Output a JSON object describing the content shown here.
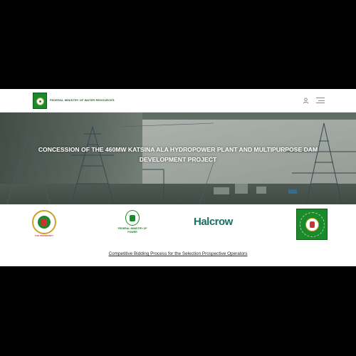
{
  "header": {
    "logo_text": "FEDERAL MINISTRY OF WATER RESOURCES",
    "icons": [
      "user-icon",
      "hamburger-menu-icon"
    ]
  },
  "hero": {
    "title": "CONCESSION OF THE 460MW KATSINA ALA HYDROPOWER PLANT AND MULTIPURPOSE DAM DEVELOPMENT PROJECT"
  },
  "partners": {
    "presidency_caption": "THE PRESIDENCY",
    "fmp_label": "FEDERAL MINISTRY OF POWER",
    "halcrow_label": "Halcrow",
    "fmwr_seal": "FEDERAL MINISTRY OF WATER RESOURCES"
  },
  "links": {
    "bidding": "Competitive Bidding Process for the Selection Prospective Operators"
  },
  "colors": {
    "brand_green": "#1a8a2a",
    "gold": "#c9a227",
    "halcrow_teal": "#1a7060"
  }
}
